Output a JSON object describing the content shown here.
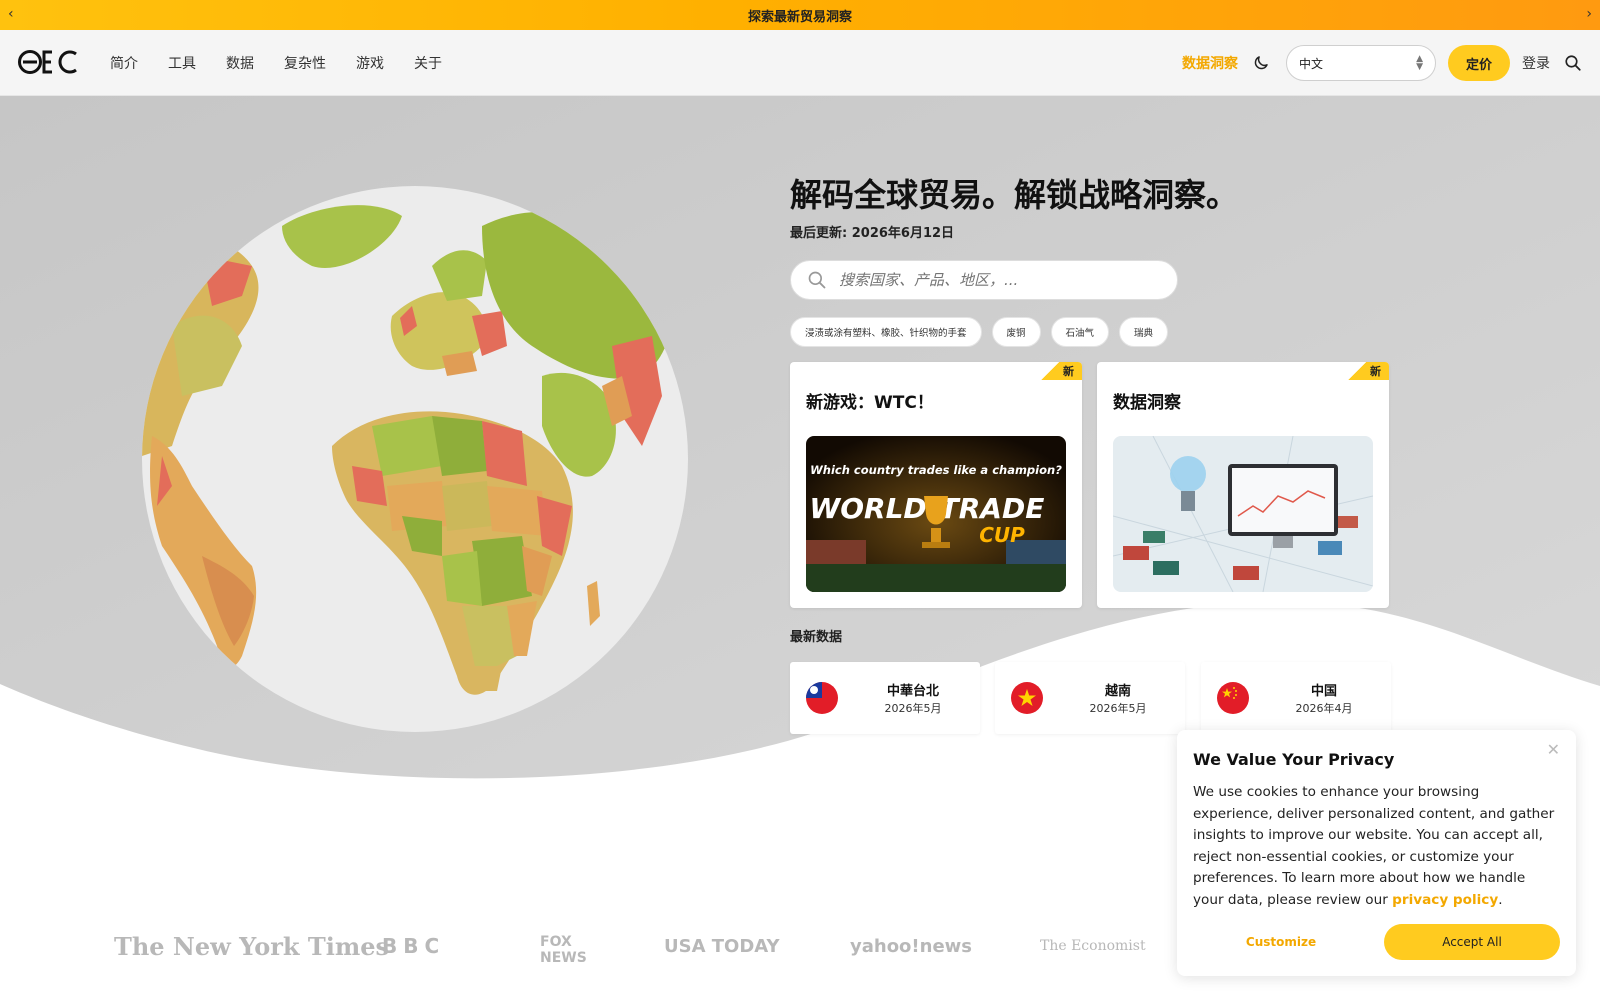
{
  "announcement": {
    "text": "探索最新贸易洞察",
    "prev_icon": "chevron-left-icon",
    "next_icon": "chevron-right-icon"
  },
  "nav": {
    "logo": "OEC",
    "links": [
      "简介",
      "工具",
      "数据",
      "复杂性",
      "游戏",
      "关于"
    ],
    "insights": "数据洞察",
    "language": "中文",
    "pricing": "定价",
    "login": "登录"
  },
  "hero": {
    "headline": "解码全球贸易。解锁战略洞察。",
    "updated": "最后更新: 2026年6月12日",
    "search_placeholder": "搜索国家、产品、地区，...",
    "chips": [
      "浸渍或涂有塑料、橡胶、针织物的手套",
      "废铜",
      "石油气",
      "瑞典"
    ]
  },
  "cards": [
    {
      "badge": "新",
      "title": "新游戏：WTC！",
      "image_caption": "Which country trades like a champion?",
      "image_title_1": "WORLD",
      "image_title_2": "TRADE",
      "image_title_3": "CUP"
    },
    {
      "badge": "新",
      "title": "数据洞察"
    }
  ],
  "latest": {
    "title": "最新数据",
    "items": [
      {
        "name": "中華台北",
        "date": "2026年5月",
        "flag": "taiwan-flag"
      },
      {
        "name": "越南",
        "date": "2026年5月",
        "flag": "vietnam-flag"
      },
      {
        "name": "中国",
        "date": "2026年4月",
        "flag": "china-flag"
      }
    ]
  },
  "press": [
    "The New York Times",
    "BBC",
    "FOX NEWS",
    "USA TODAY",
    "yahoo!news",
    "The Economist"
  ],
  "cookie": {
    "title": "We Value Your Privacy",
    "body": "We use cookies to enhance your browsing experience, deliver personalized content, and gather insights to improve our website. You can accept all, reject non-essential cookies, or customize your preferences. To learn more about how we handle your data, please review our ",
    "policy_link": "privacy policy",
    "period": ".",
    "customize": "Customize",
    "accept": "Accept All"
  },
  "colors": {
    "accent": "#ffcb1f",
    "accent_text": "#f3a800"
  }
}
